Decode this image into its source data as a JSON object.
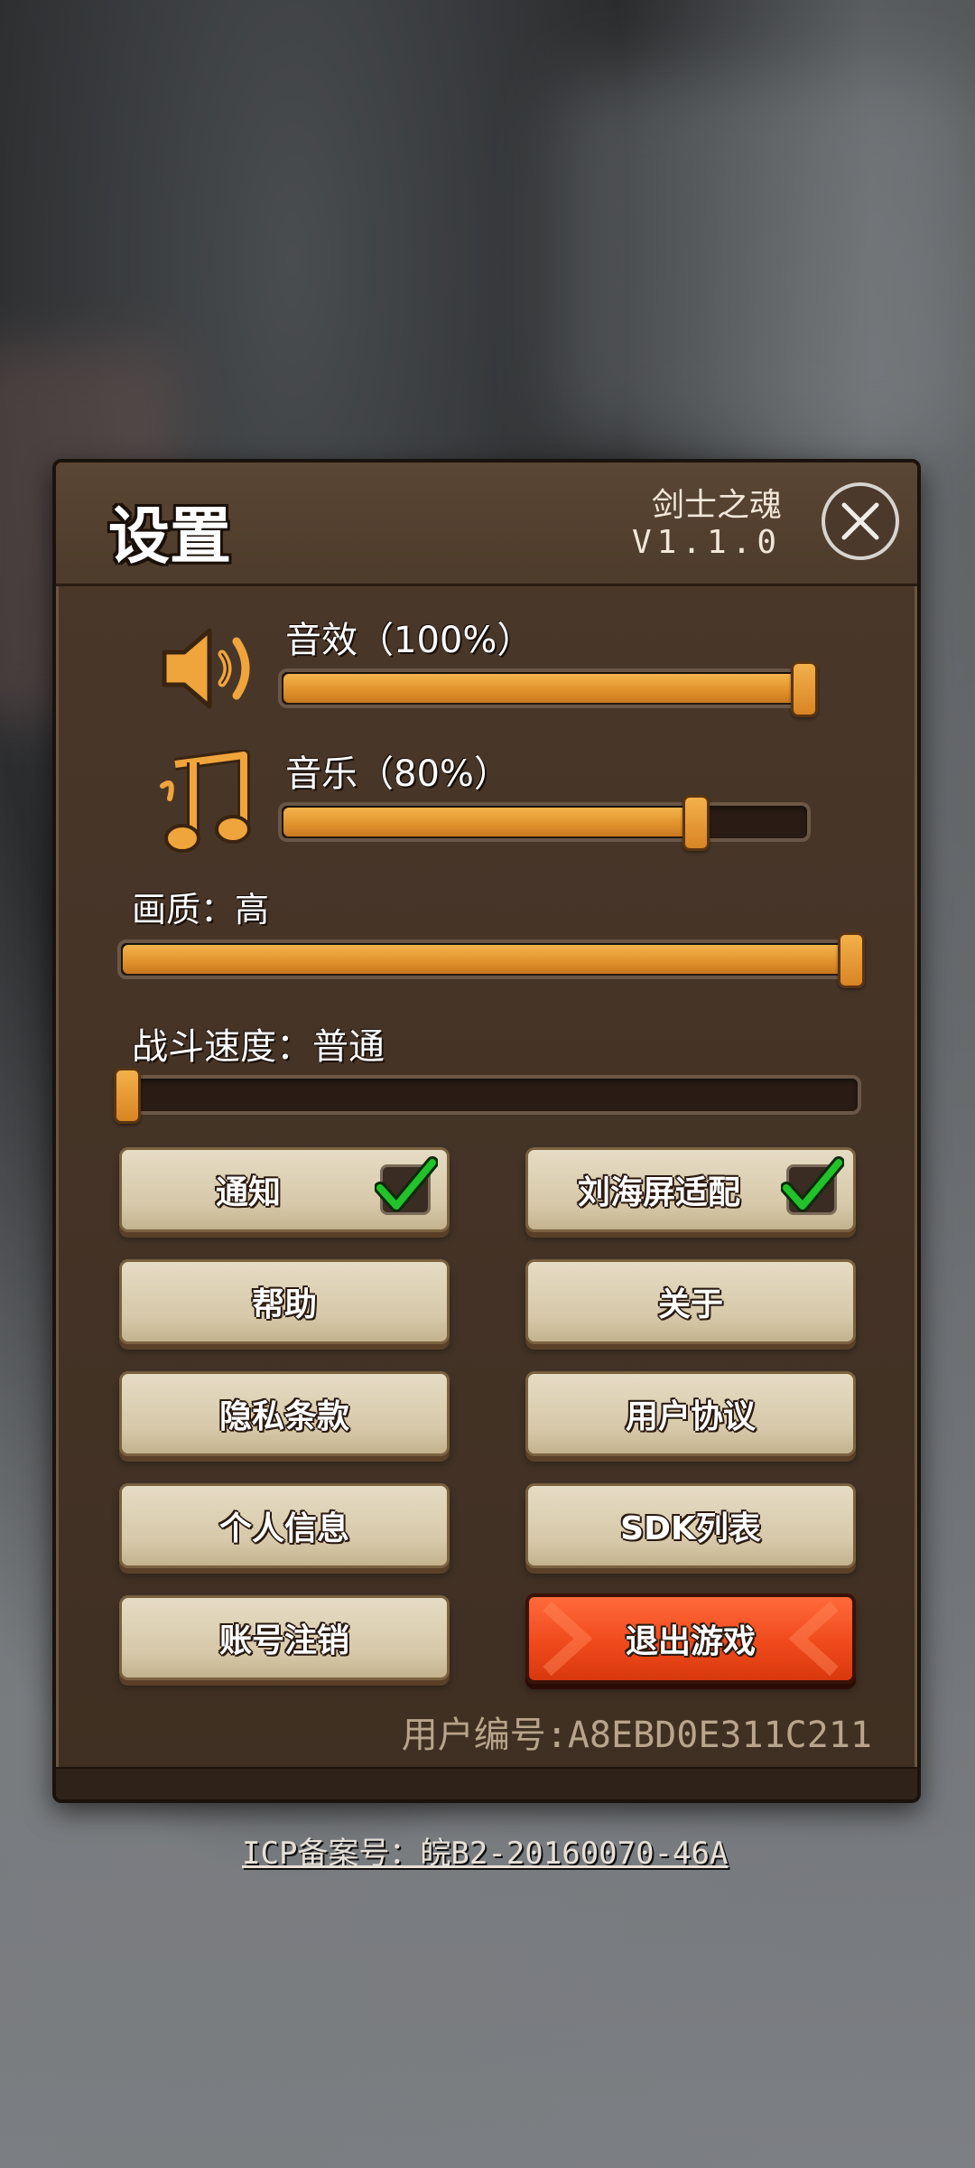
{
  "header": {
    "title": "设置",
    "game_name": "剑士之魂",
    "version": "V1.1.0"
  },
  "sliders": {
    "sound": {
      "label": "音效（100%）",
      "value": 1.0,
      "icon": "speaker-icon"
    },
    "music": {
      "label": "音乐（80%）",
      "value": 0.8,
      "icon": "music-note-icon"
    },
    "quality": {
      "label": "画质：高",
      "value": 1.0
    },
    "battle_speed": {
      "label": "战斗速度：普通",
      "value": 0.0
    }
  },
  "buttons": {
    "notify": "通知",
    "notch": "刘海屏适配",
    "help": "帮助",
    "about": "关于",
    "privacy": "隐私条款",
    "agreement": "用户协议",
    "personal_info": "个人信息",
    "sdk_list": "SDK列表",
    "delete_account": "账号注销",
    "quit_game": "退出游戏"
  },
  "toggles": {
    "notify_checked": true,
    "notch_checked": true
  },
  "user_id": "用户编号:A8EBD0E311C211",
  "icp": "ICP备案号：皖B2-20160070-46A",
  "colors": {
    "accent_orange": "#e1902a",
    "quit_red": "#f04a1c",
    "check_green": "#22c22a"
  }
}
